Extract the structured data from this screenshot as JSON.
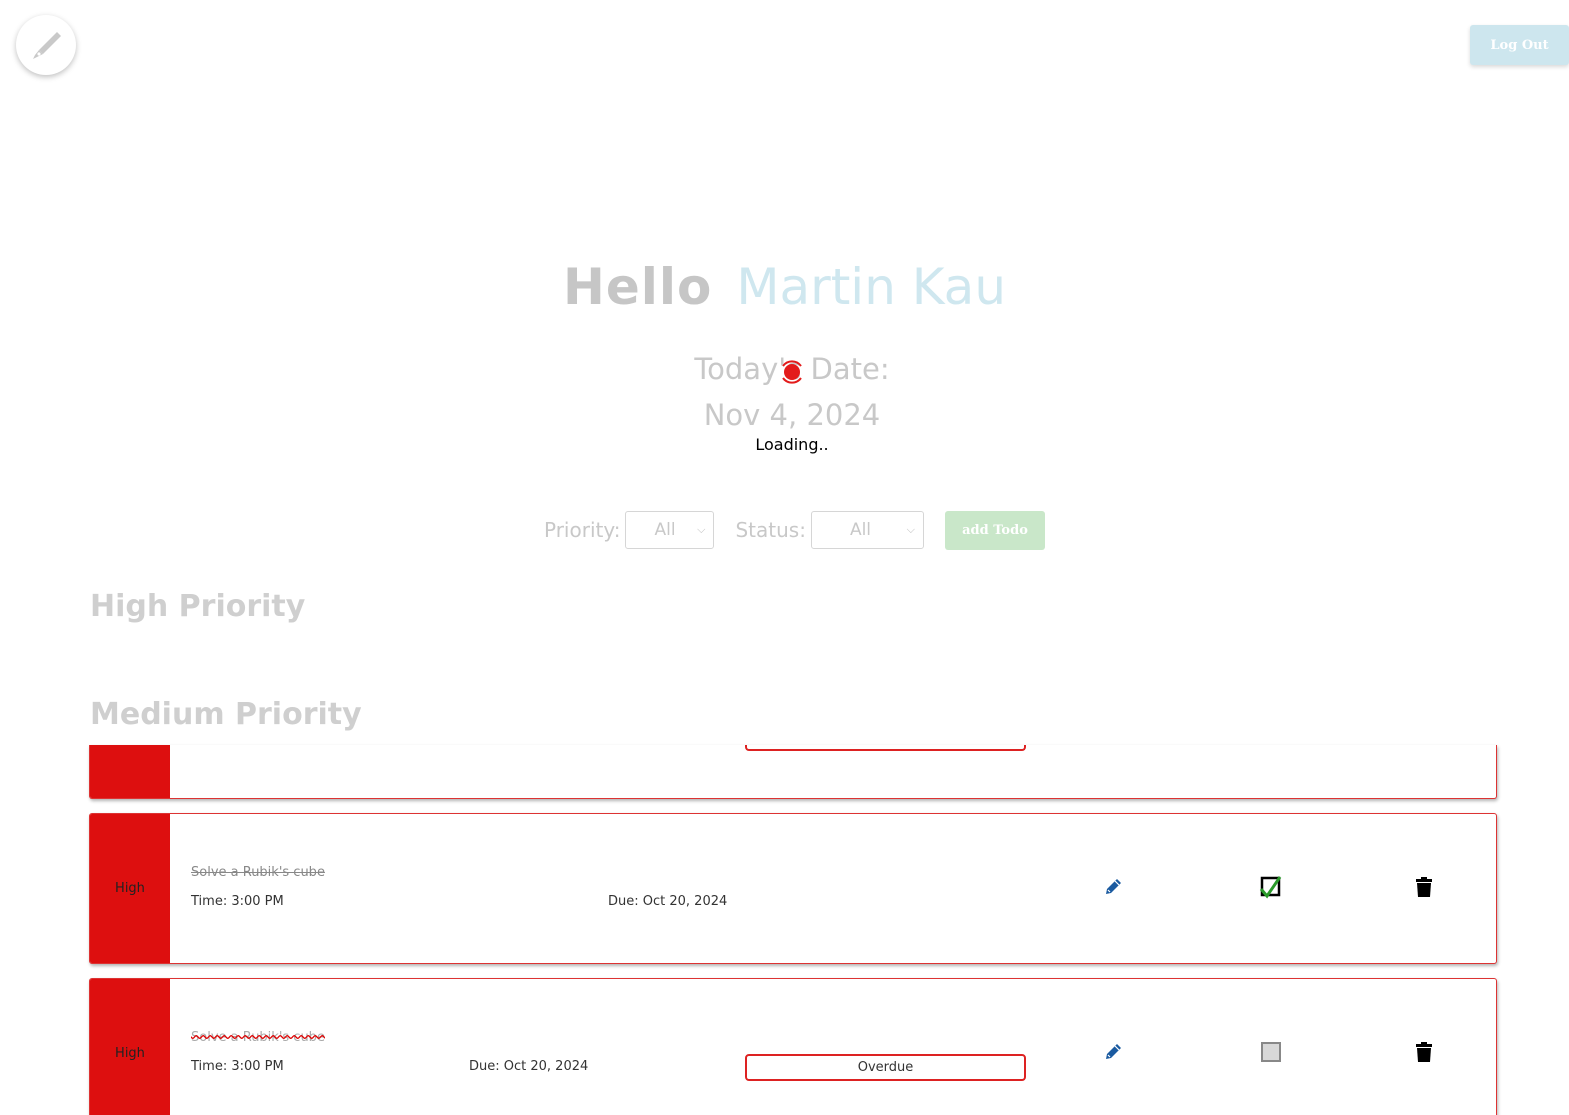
{
  "header": {
    "logo_icon": "pen-nib-icon",
    "logout_label": "Log Out"
  },
  "greeting": {
    "hello": "Hello",
    "name": "Martin Kau"
  },
  "date": {
    "label": "Today's Date:",
    "value": "Nov 4, 2024",
    "loading": "Loading.."
  },
  "filters": {
    "priority_label": "Priority:",
    "priority_value": "All",
    "status_label": "Status:",
    "status_value": "All",
    "add_label": "add Todo"
  },
  "sections": {
    "high": "High Priority",
    "medium": "Medium Priority"
  },
  "todos": [
    {
      "priority": "High",
      "title": "Solve a Rubik's cube",
      "time": "Time: 3:00 PM",
      "due": "Due: Oct 20, 2024",
      "completed": true
    },
    {
      "priority": "High",
      "title": "Solve a Rubik's cube",
      "time": "Time: 3:00 PM",
      "due": "Due: Oct 20, 2024",
      "status": "Overdue",
      "completed": false
    }
  ],
  "colors": {
    "priority_high": "#dd0f0f",
    "accent_name": "#cfe7ef",
    "add_button": "#c9e7c9",
    "edit_icon": "#1a5aa0",
    "check_icon": "#2a9a2a"
  }
}
